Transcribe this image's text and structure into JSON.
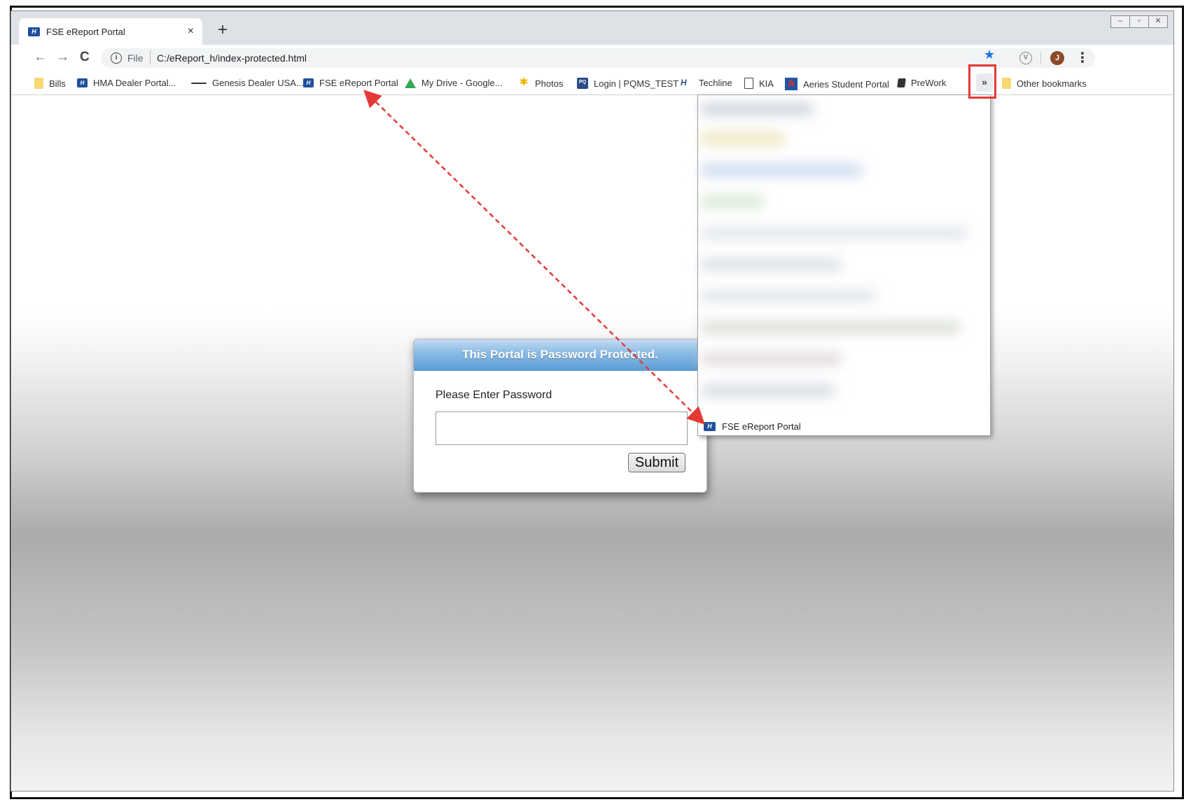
{
  "browser": {
    "tab": {
      "title": "FSE eReport Portal",
      "close": "×"
    },
    "new_tab": "+",
    "window_controls": [
      "–",
      "▫",
      "✕"
    ],
    "nav": {
      "back": "←",
      "forward": "→",
      "reload": "C"
    },
    "address": {
      "scheme_label": "File",
      "url": "C:/eReport_h/index-protected.html"
    },
    "avatar_letter": "J",
    "extension_letter": "V"
  },
  "bookmarks": {
    "items": [
      {
        "label": "Bills",
        "icon": "folder-icon"
      },
      {
        "label": "HMA Dealer Portal...",
        "icon": "hyundai-icon"
      },
      {
        "label": "Genesis Dealer USA...",
        "icon": "genesis-icon"
      },
      {
        "label": "FSE eReport Portal",
        "icon": "hyundai-icon"
      },
      {
        "label": "My Drive - Google...",
        "icon": "drive-icon"
      },
      {
        "label": "Photos",
        "icon": "photos-icon"
      },
      {
        "label": "Login | PQMS_TEST",
        "icon": "pqms-icon"
      },
      {
        "label": "Techline",
        "icon": "techline-icon"
      },
      {
        "label": "KIA",
        "icon": "document-icon"
      },
      {
        "label": "Aeries Student Portal",
        "icon": "aeries-icon"
      },
      {
        "label": "PreWork",
        "icon": "book-icon"
      }
    ],
    "overflow_button": "»",
    "other": {
      "label": "Other bookmarks",
      "icon": "folder-icon"
    }
  },
  "overflow_menu": {
    "visible_item": "FSE eReport Portal"
  },
  "dialog": {
    "title": "This Portal is Password Protected.",
    "label": "Please Enter Password",
    "input_value": "",
    "submit": "Submit"
  },
  "annotation": {
    "highlight_color": "#e53935",
    "arrow_color": "#e53935"
  }
}
